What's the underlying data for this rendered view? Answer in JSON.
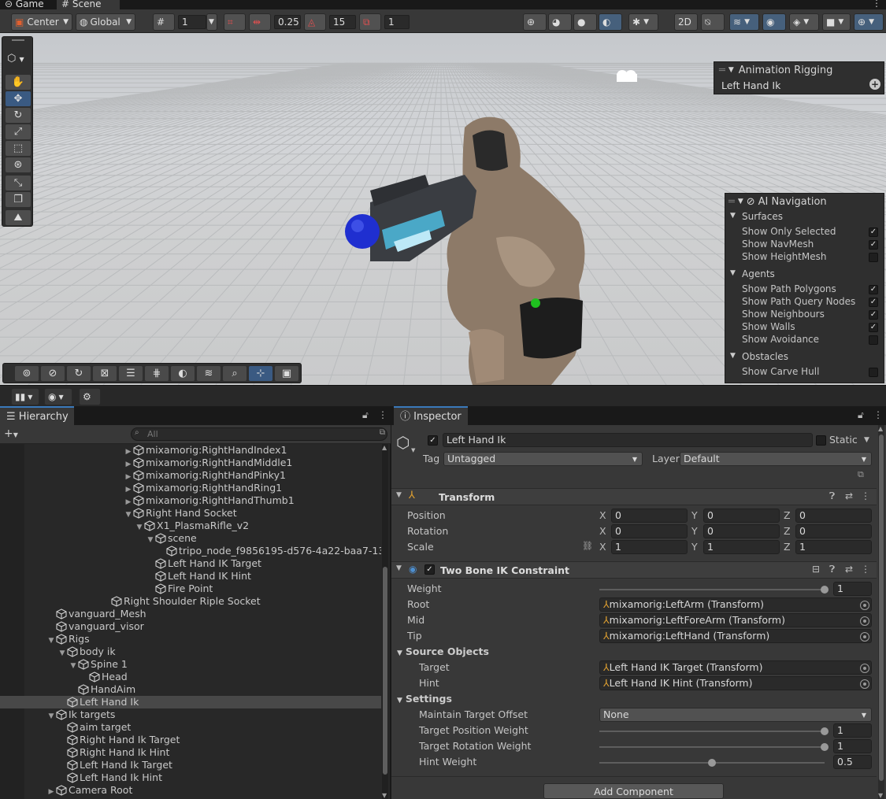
{
  "tabs": [
    {
      "label": "Game"
    },
    {
      "label": "Scene"
    }
  ],
  "scene_toolbar": {
    "pivot": "Center",
    "space": "Global",
    "grid_size": "1",
    "snap_move": "0.25",
    "snap_rotate": "15",
    "snap_scale": "1"
  },
  "overlays": {
    "animation_rigging": {
      "title": "Animation Rigging",
      "item": "Left Hand Ik"
    },
    "ai_navigation": {
      "title": "AI Navigation",
      "sections": [
        {
          "name": "Surfaces",
          "items": [
            {
              "label": "Show Only Selected",
              "checked": true
            },
            {
              "label": "Show NavMesh",
              "checked": true
            },
            {
              "label": "Show HeightMesh",
              "checked": false
            }
          ]
        },
        {
          "name": "Agents",
          "items": [
            {
              "label": "Show Path Polygons",
              "checked": true
            },
            {
              "label": "Show Path Query Nodes",
              "checked": true
            },
            {
              "label": "Show Neighbours",
              "checked": true
            },
            {
              "label": "Show Walls",
              "checked": true
            },
            {
              "label": "Show Avoidance",
              "checked": false
            }
          ]
        },
        {
          "name": "Obstacles",
          "items": [
            {
              "label": "Show Carve Hull",
              "checked": false
            }
          ]
        }
      ]
    }
  },
  "hierarchy": {
    "tab": "Hierarchy",
    "search_placeholder": "All",
    "rows": [
      {
        "label": "mixamorig:RightHandIndex1",
        "indent": 12,
        "arrow": "right",
        "sel": false
      },
      {
        "label": "mixamorig:RightHandMiddle1",
        "indent": 12,
        "arrow": "right",
        "sel": false
      },
      {
        "label": "mixamorig:RightHandPinky1",
        "indent": 12,
        "arrow": "right",
        "sel": false
      },
      {
        "label": "mixamorig:RightHandRing1",
        "indent": 12,
        "arrow": "right",
        "sel": false
      },
      {
        "label": "mixamorig:RightHandThumb1",
        "indent": 12,
        "arrow": "right",
        "sel": false
      },
      {
        "label": "Right Hand Socket",
        "indent": 12,
        "arrow": "down",
        "sel": false
      },
      {
        "label": "X1_PlasmaRifle_v2",
        "indent": 13,
        "arrow": "down",
        "sel": false
      },
      {
        "label": "scene",
        "indent": 14,
        "arrow": "down",
        "sel": false
      },
      {
        "label": "tripo_node_f9856195-d576-4a22-baa7-13",
        "indent": 15,
        "arrow": "none",
        "sel": false
      },
      {
        "label": "Left Hand IK Target",
        "indent": 14,
        "arrow": "none",
        "sel": false
      },
      {
        "label": "Left Hand IK Hint",
        "indent": 14,
        "arrow": "none",
        "sel": false
      },
      {
        "label": "Fire Point",
        "indent": 14,
        "arrow": "none",
        "sel": false
      },
      {
        "label": "Right Shoulder Riple Socket",
        "indent": 10,
        "arrow": "none",
        "sel": false
      },
      {
        "label": "vanguard_Mesh",
        "indent": 5,
        "arrow": "none",
        "sel": false
      },
      {
        "label": "vanguard_visor",
        "indent": 5,
        "arrow": "none",
        "sel": false
      },
      {
        "label": "Rigs",
        "indent": 5,
        "arrow": "down",
        "sel": false
      },
      {
        "label": "body ik",
        "indent": 6,
        "arrow": "down",
        "sel": false
      },
      {
        "label": "Spine 1",
        "indent": 7,
        "arrow": "down",
        "sel": false
      },
      {
        "label": "Head",
        "indent": 8,
        "arrow": "none",
        "sel": false
      },
      {
        "label": "HandAim",
        "indent": 7,
        "arrow": "none",
        "sel": false
      },
      {
        "label": "Left Hand Ik",
        "indent": 6,
        "arrow": "none",
        "sel": true
      },
      {
        "label": "Ik targets",
        "indent": 5,
        "arrow": "down",
        "sel": false
      },
      {
        "label": "aim target",
        "indent": 6,
        "arrow": "none",
        "sel": false
      },
      {
        "label": "Right Hand Ik Target",
        "indent": 6,
        "arrow": "none",
        "sel": false
      },
      {
        "label": "Right Hand Ik Hint",
        "indent": 6,
        "arrow": "none",
        "sel": false
      },
      {
        "label": "Left Hand Ik Target",
        "indent": 6,
        "arrow": "none",
        "sel": false
      },
      {
        "label": "Left Hand Ik Hint",
        "indent": 6,
        "arrow": "none",
        "sel": false
      },
      {
        "label": "Camera Root",
        "indent": 5,
        "arrow": "right",
        "sel": false
      }
    ]
  },
  "inspector": {
    "tab": "Inspector",
    "object_name": "Left Hand Ik",
    "static_label": "Static",
    "tag_label": "Tag",
    "tag_value": "Untagged",
    "layer_label": "Layer",
    "layer_value": "Default",
    "transform": {
      "title": "Transform",
      "position": {
        "label": "Position",
        "x": "0",
        "y": "0",
        "z": "0"
      },
      "rotation": {
        "label": "Rotation",
        "x": "0",
        "y": "0",
        "z": "0"
      },
      "scale": {
        "label": "Scale",
        "x": "1",
        "y": "1",
        "z": "1"
      }
    },
    "constraint": {
      "title": "Two Bone IK Constraint",
      "weight_label": "Weight",
      "weight": "1",
      "weight_fraction": 1.0,
      "root_label": "Root",
      "root": "mixamorig:LeftArm (Transform)",
      "mid_label": "Mid",
      "mid": "mixamorig:LeftForeArm (Transform)",
      "tip_label": "Tip",
      "tip": "mixamorig:LeftHand (Transform)",
      "source_label": "Source Objects",
      "target_label": "Target",
      "target": "Left Hand IK Target (Transform)",
      "hint_label": "Hint",
      "hint": "Left Hand IK Hint (Transform)",
      "settings_label": "Settings",
      "offset_label": "Maintain Target Offset",
      "offset": "None",
      "tpw_label": "Target Position Weight",
      "tpw": "1",
      "tpw_fraction": 1.0,
      "trw_label": "Target Rotation Weight",
      "trw": "1",
      "trw_fraction": 1.0,
      "hw_label": "Hint Weight",
      "hw": "0.5",
      "hw_fraction": 0.5
    },
    "add_component": "Add Component"
  },
  "colors": {
    "accent": "#3a79bb",
    "selected_row": "#484848",
    "sphere_blue": "#1f2fd0",
    "sphere_green": "#1fc01f"
  }
}
